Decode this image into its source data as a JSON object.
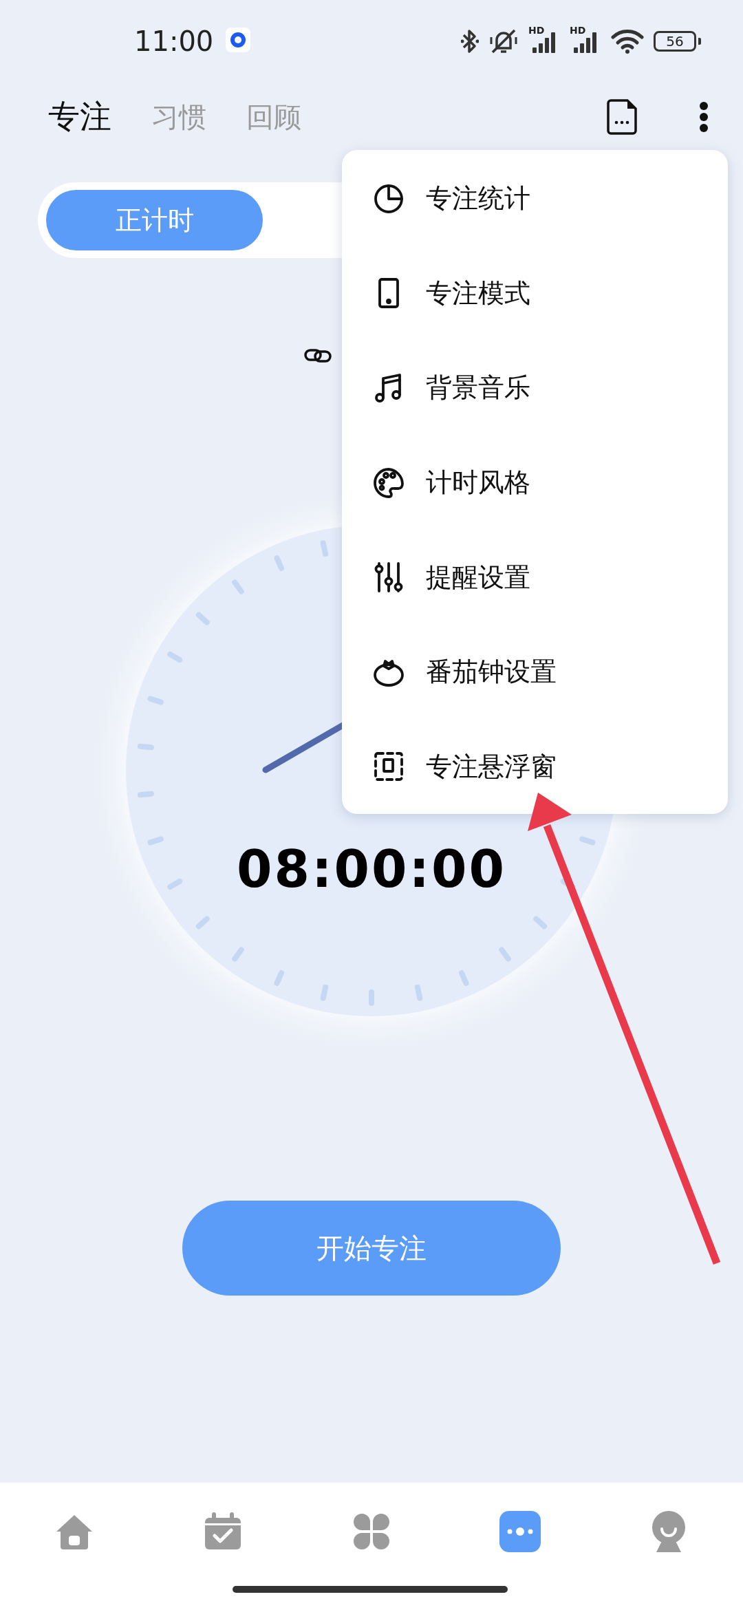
{
  "status_bar": {
    "time": "11:00",
    "signals": [
      {
        "label": "HD"
      },
      {
        "label": "HD"
      }
    ],
    "battery": "56"
  },
  "header": {
    "tabs": [
      {
        "label": "专注",
        "selected": true
      },
      {
        "label": "习惯",
        "selected": false
      },
      {
        "label": "回顾",
        "selected": false
      }
    ]
  },
  "mode_switch": {
    "segments": [
      {
        "label": "正计时",
        "selected": true
      }
    ]
  },
  "timer": {
    "display": "08:00:00"
  },
  "start_button": {
    "label": "开始专注"
  },
  "menu": {
    "items": [
      {
        "label": "专注统计",
        "kind": "stats"
      },
      {
        "label": "专注模式",
        "kind": "mode"
      },
      {
        "label": "背景音乐",
        "kind": "music"
      },
      {
        "label": "计时风格",
        "kind": "style"
      },
      {
        "label": "提醒设置",
        "kind": "reminder"
      },
      {
        "label": "番茄钟设置",
        "kind": "pomodoro"
      },
      {
        "label": "专注悬浮窗",
        "kind": "floating"
      }
    ]
  },
  "bottom_nav": {
    "items": [
      {
        "kind": "home",
        "selected": false
      },
      {
        "kind": "calendar",
        "selected": false
      },
      {
        "kind": "apps",
        "selected": false
      },
      {
        "kind": "more",
        "selected": true
      },
      {
        "kind": "profile",
        "selected": false
      }
    ]
  }
}
